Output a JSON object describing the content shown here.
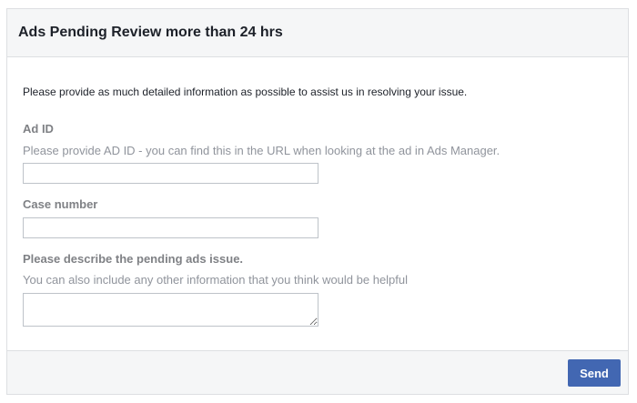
{
  "dialog": {
    "title": "Ads Pending Review more than 24 hrs",
    "intro": "Please provide as much detailed information as possible to assist us in resolving your issue."
  },
  "form": {
    "ad_id": {
      "label": "Ad ID",
      "help": "Please provide AD ID - you can find this in the URL when looking at the ad in Ads Manager.",
      "value": "",
      "placeholder": ""
    },
    "case_number": {
      "label": "Case number",
      "value": "",
      "placeholder": ""
    },
    "issue_description": {
      "label": "Please describe the pending ads issue.",
      "help": "You can also include any other information that you think would be helpful",
      "value": "",
      "placeholder": ""
    }
  },
  "footer": {
    "send_label": "Send"
  },
  "colors": {
    "primary_button": "#4267b2",
    "header_background": "#f5f6f7",
    "border": "#dddfe2",
    "label_text": "#7f8185",
    "help_text": "#90949c"
  }
}
